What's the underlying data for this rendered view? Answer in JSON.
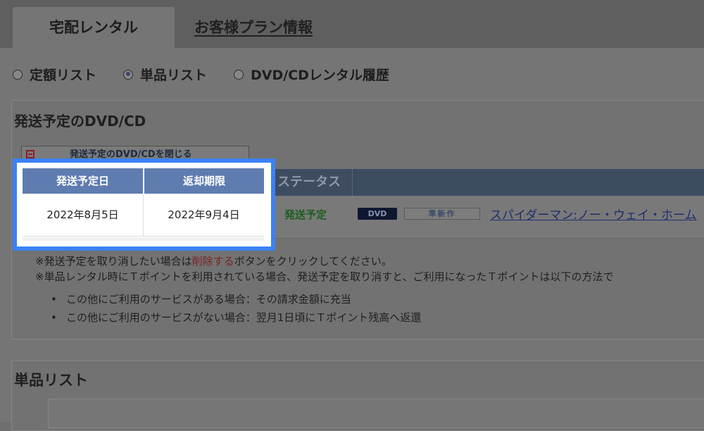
{
  "tabs": [
    {
      "label": "宅配レンタル",
      "active": true
    },
    {
      "label": "お客様プラン情報",
      "active": false
    }
  ],
  "radio_options": [
    {
      "label": "定額リスト",
      "selected": false
    },
    {
      "label": "単品リスト",
      "selected": true
    },
    {
      "label": "DVD/CDレンタル履歴",
      "selected": false
    }
  ],
  "shipment_section": {
    "title": "発送予定のDVD/CD",
    "collapse_button": "発送予定のDVD/CDを閉じる",
    "headers": {
      "ship_date": "発送予定日",
      "return_deadline": "返却期限",
      "status": "ステータス"
    },
    "row": {
      "ship_date": "2022年8月5日",
      "return_deadline": "2022年9月4日",
      "status": "発送予定",
      "format_badge": "DVD",
      "release_badge": "準新作",
      "title": "スパイダーマン:ノー・ウェイ・ホーム"
    },
    "notes": {
      "line1_prefix": "※発送予定を取り消したい場合は",
      "line1_link": "削除する",
      "line1_suffix": "ボタンをクリックしてください。",
      "line2": "※単品レンタル時にＴポイントを利用されている場合、発送予定を取り消すと、ご利用になったＴポイントは以下の方法で",
      "bullet1": "この他にご利用のサービスがある場合：その請求金額に充当",
      "bullet2": "この他にご利用のサービスがない場合：翌月1日頃にＴポイント残高へ返還"
    }
  },
  "single_list_section": {
    "title": "単品リスト"
  },
  "colors": {
    "highlight_border": "#3b82f6",
    "table_header": "#5f7cb0",
    "status_green": "#1e5e1e"
  }
}
